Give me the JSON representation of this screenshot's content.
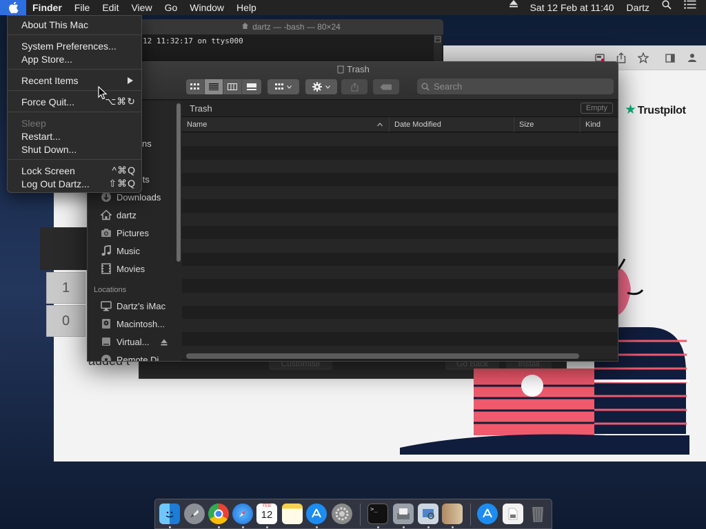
{
  "menubar": {
    "app_name": "Finder",
    "menus": [
      "File",
      "Edit",
      "View",
      "Go",
      "Window",
      "Help"
    ],
    "clock": "Sat 12 Feb at  11:40",
    "user": "Dartz"
  },
  "apple_menu": {
    "items": [
      {
        "label": "About This Mac",
        "shortcut": "",
        "disabled": false
      },
      {
        "label": "System Preferences...",
        "shortcut": "",
        "disabled": false
      },
      {
        "label": "App Store...",
        "shortcut": "",
        "disabled": false
      },
      {
        "label": "Recent Items",
        "shortcut": "",
        "submenu": true,
        "disabled": false
      },
      {
        "label": "Force Quit...",
        "shortcut": "⌥⌘↻",
        "disabled": false
      },
      {
        "label": "Sleep",
        "shortcut": "",
        "disabled": true
      },
      {
        "label": "Restart...",
        "shortcut": "",
        "disabled": false
      },
      {
        "label": "Shut Down...",
        "shortcut": "",
        "disabled": false
      },
      {
        "label": "Lock Screen",
        "shortcut": "^⌘Q",
        "disabled": false
      },
      {
        "label": "Log Out Dartz...",
        "shortcut": "⇧⌘Q",
        "disabled": false
      }
    ]
  },
  "terminal": {
    "title": "dartz — -bash — 80×24",
    "line": "12 11:32:17 on ttys000"
  },
  "finder": {
    "title": "Trash",
    "search_placeholder": "Search",
    "path_label": "Trash",
    "empty_button": "Empty",
    "columns": [
      "Name",
      "Date Modified",
      "Size",
      "Kind"
    ],
    "sidebar": {
      "favorites_partial": [
        "ts",
        "ations",
        "op",
        "nents"
      ],
      "items": [
        {
          "label": "Downloads",
          "icon": "download-icon"
        },
        {
          "label": "dartz",
          "icon": "home-icon"
        },
        {
          "label": "Pictures",
          "icon": "camera-icon"
        },
        {
          "label": "Music",
          "icon": "music-icon"
        },
        {
          "label": "Movies",
          "icon": "film-icon"
        }
      ],
      "locations_header": "Locations",
      "locations": [
        {
          "label": "Dartz's iMac",
          "icon": "computer-icon"
        },
        {
          "label": "Macintosh...",
          "icon": "disk-icon"
        },
        {
          "label": "Virtual...",
          "icon": "disk-icon",
          "eject": true
        },
        {
          "label": "Remote Di...",
          "icon": "remote-disk-icon"
        }
      ]
    }
  },
  "browser": {
    "brand": "Trustpilot",
    "partial_text": "added t"
  },
  "calculator": {
    "keys": [
      "1",
      "0"
    ]
  },
  "installer": {
    "buttons": [
      "Customise",
      "Go Back",
      "Install"
    ]
  },
  "dock": {
    "apps": [
      "Finder",
      "Launchpad",
      "Chrome",
      "Safari",
      "Calendar",
      "Notes",
      "App Store",
      "System Preferences",
      "Terminal",
      "Scanner",
      "Preview",
      "Archive",
      "App Store Folder",
      "Documents",
      "Trash"
    ],
    "calendar_day": "12",
    "calendar_month": "FEB"
  }
}
